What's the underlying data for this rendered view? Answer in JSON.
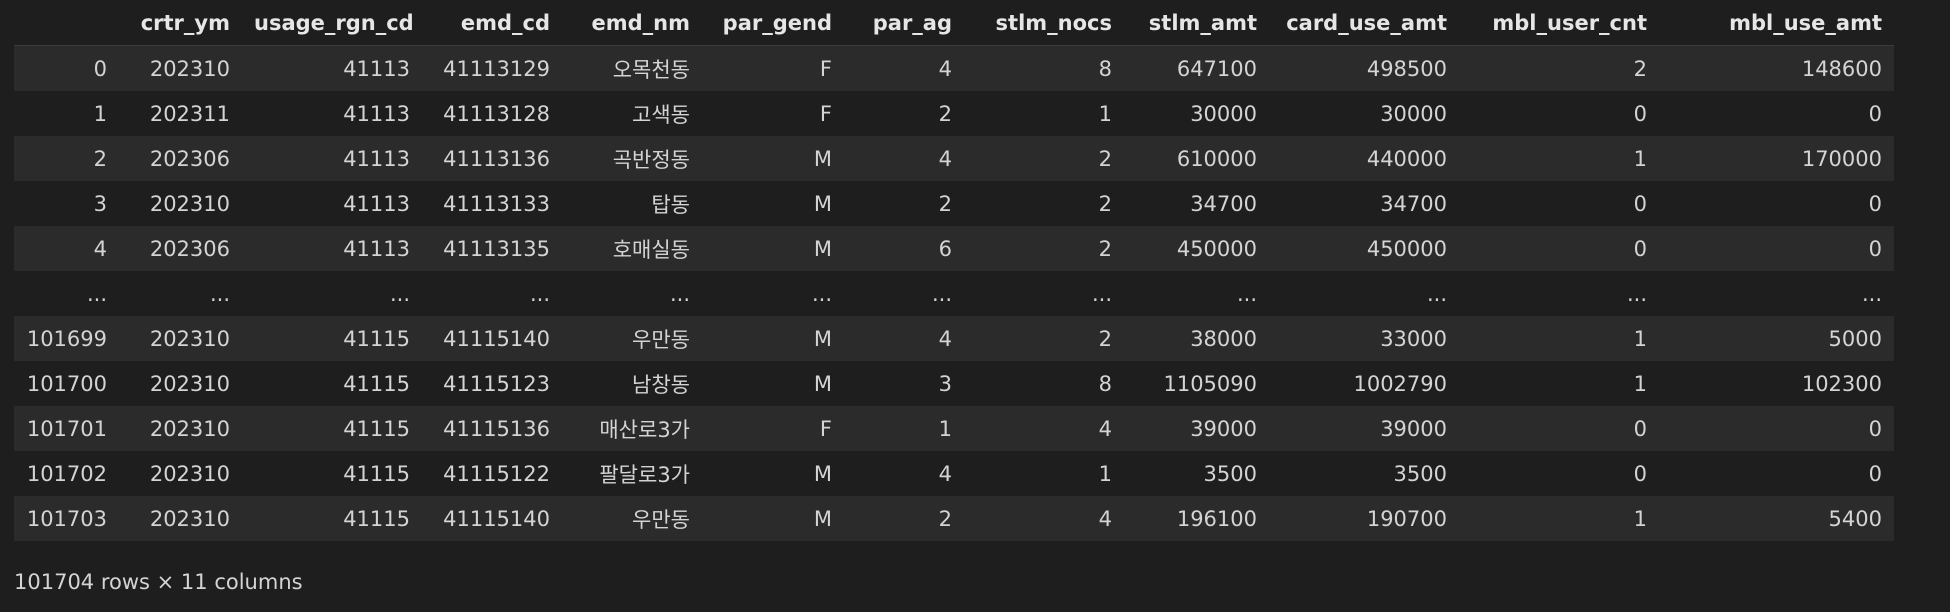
{
  "dataframe": {
    "index_header": "",
    "columns": [
      "crtr_ym",
      "usage_rgn_cd",
      "emd_cd",
      "emd_nm",
      "par_gend",
      "par_ag",
      "stlm_nocs",
      "stlm_amt",
      "card_use_amt",
      "mbl_user_cnt",
      "mbl_use_amt"
    ],
    "rows": [
      {
        "index": "0",
        "cells": [
          "202310",
          "41113",
          "41113129",
          "오목천동",
          "F",
          "4",
          "8",
          "647100",
          "498500",
          "2",
          "148600"
        ]
      },
      {
        "index": "1",
        "cells": [
          "202311",
          "41113",
          "41113128",
          "고색동",
          "F",
          "2",
          "1",
          "30000",
          "30000",
          "0",
          "0"
        ]
      },
      {
        "index": "2",
        "cells": [
          "202306",
          "41113",
          "41113136",
          "곡반정동",
          "M",
          "4",
          "2",
          "610000",
          "440000",
          "1",
          "170000"
        ]
      },
      {
        "index": "3",
        "cells": [
          "202310",
          "41113",
          "41113133",
          "탑동",
          "M",
          "2",
          "2",
          "34700",
          "34700",
          "0",
          "0"
        ]
      },
      {
        "index": "4",
        "cells": [
          "202306",
          "41113",
          "41113135",
          "호매실동",
          "M",
          "6",
          "2",
          "450000",
          "450000",
          "0",
          "0"
        ]
      },
      {
        "index": "...",
        "cells": [
          "...",
          "...",
          "...",
          "...",
          "...",
          "...",
          "...",
          "...",
          "...",
          "...",
          "..."
        ]
      },
      {
        "index": "101699",
        "cells": [
          "202310",
          "41115",
          "41115140",
          "우만동",
          "M",
          "4",
          "2",
          "38000",
          "33000",
          "1",
          "5000"
        ]
      },
      {
        "index": "101700",
        "cells": [
          "202310",
          "41115",
          "41115123",
          "남창동",
          "M",
          "3",
          "8",
          "1105090",
          "1002790",
          "1",
          "102300"
        ]
      },
      {
        "index": "101701",
        "cells": [
          "202310",
          "41115",
          "41115136",
          "매산로3가",
          "F",
          "1",
          "4",
          "39000",
          "39000",
          "0",
          "0"
        ]
      },
      {
        "index": "101702",
        "cells": [
          "202310",
          "41115",
          "41115122",
          "팔달로3가",
          "M",
          "4",
          "1",
          "3500",
          "3500",
          "0",
          "0"
        ]
      },
      {
        "index": "101703",
        "cells": [
          "202310",
          "41115",
          "41115140",
          "우만동",
          "M",
          "2",
          "4",
          "196100",
          "190700",
          "1",
          "5400"
        ]
      }
    ],
    "shape_text": "101704 rows × 11 columns"
  },
  "colors": {
    "background": "#1e1e1e",
    "row_stripe": "#2b2b2b",
    "text": "#d4d4d4"
  }
}
